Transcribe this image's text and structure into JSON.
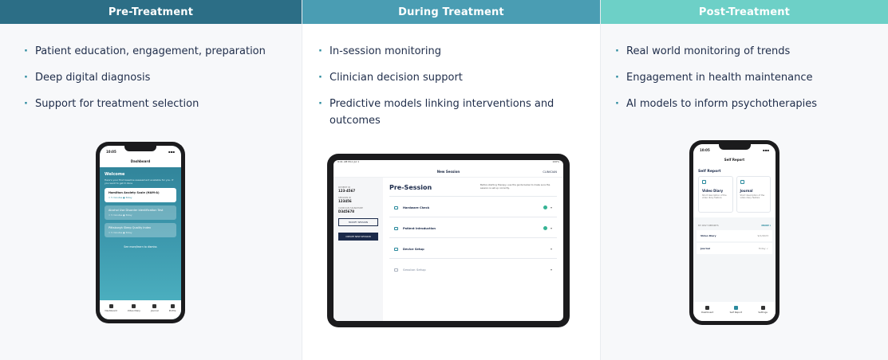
{
  "columns": [
    {
      "header": "Pre-Treatment",
      "bullets": [
        "Patient education, engagement, preparation",
        "Deep digital diagnosis",
        "Support for treatment selection"
      ]
    },
    {
      "header": "During Treatment",
      "bullets": [
        "In-session monitoring",
        "Clinician decision support",
        "Predictive models linking interventions and outcomes"
      ]
    },
    {
      "header": "Post-Treatment",
      "bullets": [
        "Real world monitoring of trends",
        "Engagement in health maintenance",
        "AI models to inform psychotherapies"
      ]
    }
  ],
  "bullet_glyph": "·",
  "phone1": {
    "time": "10:05",
    "nav_title": "Dashboard",
    "welcome": "Welcome",
    "welcome_text": "Here's your first baseline assessment available for you. If you want to get it done",
    "cards": [
      {
        "title": "Hamilton Anxiety Scale (HAM-A)",
        "sub": "≈ 5 minutes  ● Today"
      },
      {
        "title": "Alcohol Use Disorder Identification Test",
        "sub": "≈ 5 minutes  ● Today"
      },
      {
        "title": "Pittsburgh Sleep Quality Index",
        "sub": "≈ 5 minutes  ● Today"
      }
    ],
    "see_more": "See more/learn to dismiss",
    "tabs": [
      "Dashboard",
      "Video Diary",
      "Journal",
      "Profile"
    ]
  },
  "tablet": {
    "time": "9:41 AM  Mon Jul 1",
    "battery": "100%",
    "top_title": "New Session",
    "user": "CLINICIAN",
    "side": [
      {
        "label": "PATIENT ID",
        "value": "123-4567"
      },
      {
        "label": "SESSION ID",
        "value": "123456"
      },
      {
        "label": "CLINICIAN SIGNATURE",
        "value": "D345678"
      }
    ],
    "btn_secondary": "MODIFY SESSION",
    "btn_primary": "CREATE NEW SESSION",
    "title": "Pre-Session",
    "description": "Before starting therapy, use the guide below to make sure the session is set up correctly.",
    "rows": [
      {
        "label": "Hardware Check",
        "ok": true,
        "dim": false
      },
      {
        "label": "Patient Introduction",
        "ok": true,
        "dim": false
      },
      {
        "label": "Device Setup",
        "ok": false,
        "dim": false
      },
      {
        "label": "Session Setup",
        "ok": false,
        "dim": true
      }
    ]
  },
  "phone3": {
    "time": "10:05",
    "nav_title": "Self Report",
    "section": "Self Report",
    "cards": [
      {
        "title": "Video Diary",
        "desc": "Short description of the video diary feature"
      },
      {
        "title": "Journal",
        "desc": "Short description of the video diary feature"
      }
    ],
    "recent_label": "MY PAST REPORTS",
    "recent_more": "MORE ▾",
    "recent_items": [
      {
        "title": "Video Diary",
        "date": "9/1/2023"
      },
      {
        "title": "Journal",
        "date": "Today  ✓"
      }
    ],
    "tabs": [
      "Dashboard",
      "Self Report",
      "Settings"
    ]
  }
}
